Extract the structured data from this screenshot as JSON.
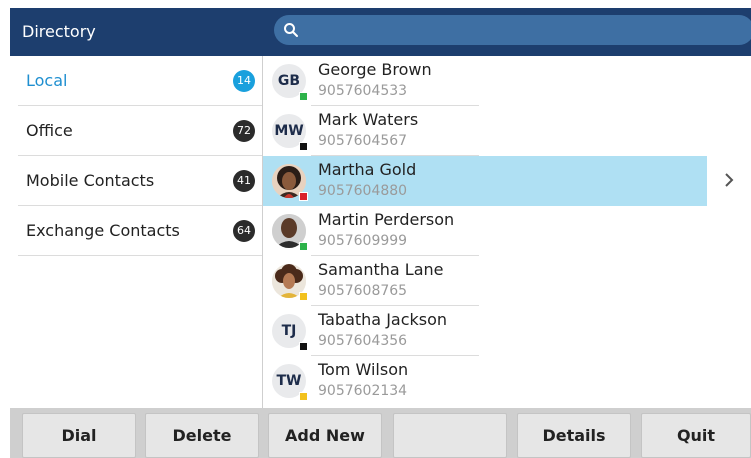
{
  "header": {
    "title": "Directory",
    "search_placeholder": ""
  },
  "sidebar": {
    "items": [
      {
        "label": "Local",
        "count": "14"
      },
      {
        "label": "Office",
        "count": "72"
      },
      {
        "label": "Mobile Contacts",
        "count": "41"
      },
      {
        "label": "Exchange Contacts",
        "count": "64"
      }
    ],
    "selected": "Local"
  },
  "contacts": [
    {
      "initials": "GB",
      "name": "George Brown",
      "number": "9057604533",
      "presence_color": "#2db24a"
    },
    {
      "initials": "MW",
      "name": "Mark Waters",
      "number": "9057604567",
      "presence_color": "#111111"
    },
    {
      "initials": "",
      "name": "Martha Gold",
      "number": "9057604880",
      "presence_color": "#d9202a",
      "photo": "woman-photo",
      "selected": true
    },
    {
      "initials": "",
      "name": "Martin Perderson",
      "number": "9057609999",
      "presence_color": "#2db24a",
      "photo": "man-photo"
    },
    {
      "initials": "",
      "name": "Samantha Lane",
      "number": "9057608765",
      "presence_color": "#f2c11d",
      "photo": "woman-curly-photo"
    },
    {
      "initials": "TJ",
      "name": "Tabatha Jackson",
      "number": "9057604356",
      "presence_color": "#111111"
    },
    {
      "initials": "TW",
      "name": "Tom Wilson",
      "number": "9057602134",
      "presence_color": "#f2c11d"
    }
  ],
  "softkeys": {
    "dial": "Dial",
    "delete": "Delete",
    "add_new": "Add New",
    "blank": "",
    "details": "Details",
    "quit": "Quit"
  },
  "colors": {
    "header_bg": "#1d3e6e",
    "search_bg": "#3e6fa3",
    "accent": "#19a0dd",
    "selected_row": "#afe0f3"
  }
}
